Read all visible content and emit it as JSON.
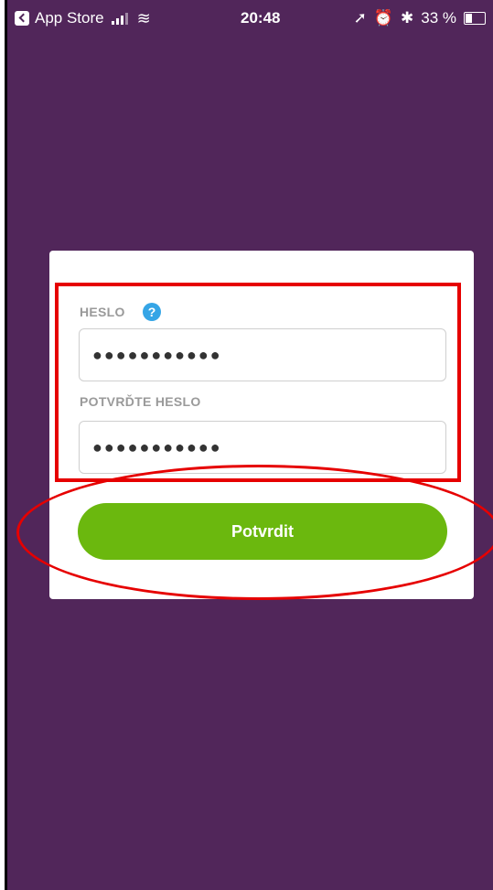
{
  "status_bar": {
    "back_app": "App Store",
    "time": "20:48",
    "battery": "33 %",
    "icons": [
      "back-icon",
      "signal-icon",
      "wifi-icon",
      "location-icon",
      "alarm-icon",
      "bluetooth-icon",
      "battery-icon"
    ]
  },
  "form": {
    "password_label": "HESLO",
    "help_icon_glyph": "?",
    "password_value": "●●●●●●●●●●●",
    "confirm_label": "POTVRĎTE HESLO",
    "confirm_value": "●●●●●●●●●●●",
    "submit_label": "Potvrdit"
  },
  "colors": {
    "background": "#51265a",
    "card": "#ffffff",
    "button": "#6bb80e",
    "help_icon": "#35a5e6",
    "annotation": "#e60000"
  }
}
